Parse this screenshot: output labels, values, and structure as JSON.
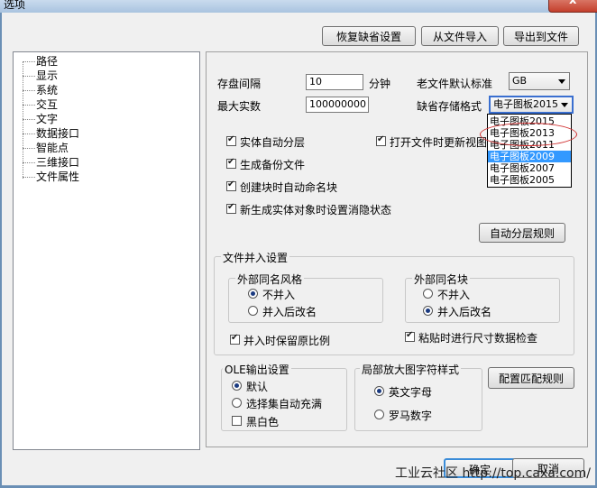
{
  "window": {
    "title": "选项",
    "close_label": "x"
  },
  "toolbar": {
    "restore_defaults": "恢复缺省设置",
    "import_from_file": "从文件导入",
    "export_to_file": "导出到文件"
  },
  "tree": {
    "items": [
      "路径",
      "显示",
      "系统",
      "交互",
      "文字",
      "数据接口",
      "智能点",
      "三维接口",
      "文件属性"
    ]
  },
  "settings": {
    "autosave_label": "存盘间隔",
    "autosave_value": "10",
    "autosave_unit": "分钟",
    "max_entities_label": "最大实数",
    "max_entities_value": "100000000",
    "legacy_standard_label": "老文件默认标准",
    "legacy_standard_value": "GB",
    "save_format_label": "缺省存储格式",
    "save_format_value": "电子图板2015"
  },
  "format_dropdown": {
    "options": [
      "电子图板2015",
      "电子图板2013",
      "电子图板2011",
      "电子图板2009",
      "电子图板2007",
      "电子图板2005"
    ],
    "selected_index": 3
  },
  "checks": {
    "auto_layer": "实体自动分层",
    "update_view_on_open": "打开文件时更新视图",
    "backup": "生成备份文件",
    "auto_name_block": "创建块时自动命名块",
    "hide_state": "新生成实体对象时设置消隐状态"
  },
  "auto_layer_rules": "自动分层规则",
  "merge": {
    "title": "文件并入设置",
    "style_group": "外部同名风格",
    "block_group": "外部同名块",
    "no_merge": "不并入",
    "rename_merge": "并入后改名",
    "keep_scale": "并入时保留原比例",
    "size_check": "粘贴时进行尺寸数据检查"
  },
  "ole": {
    "title": "OLE输出设置",
    "default": "默认",
    "fill_selection": "选择集自动充满",
    "monochrome": "黑白色"
  },
  "zoom_style": {
    "title": "局部放大图字符样式",
    "english": "英文字母",
    "roman": "罗马数字"
  },
  "match_rules": "配置匹配规则",
  "footer": {
    "ok": "确定",
    "cancel": "取消"
  },
  "watermark": "工业云社区 http://top.caxa.com/"
}
